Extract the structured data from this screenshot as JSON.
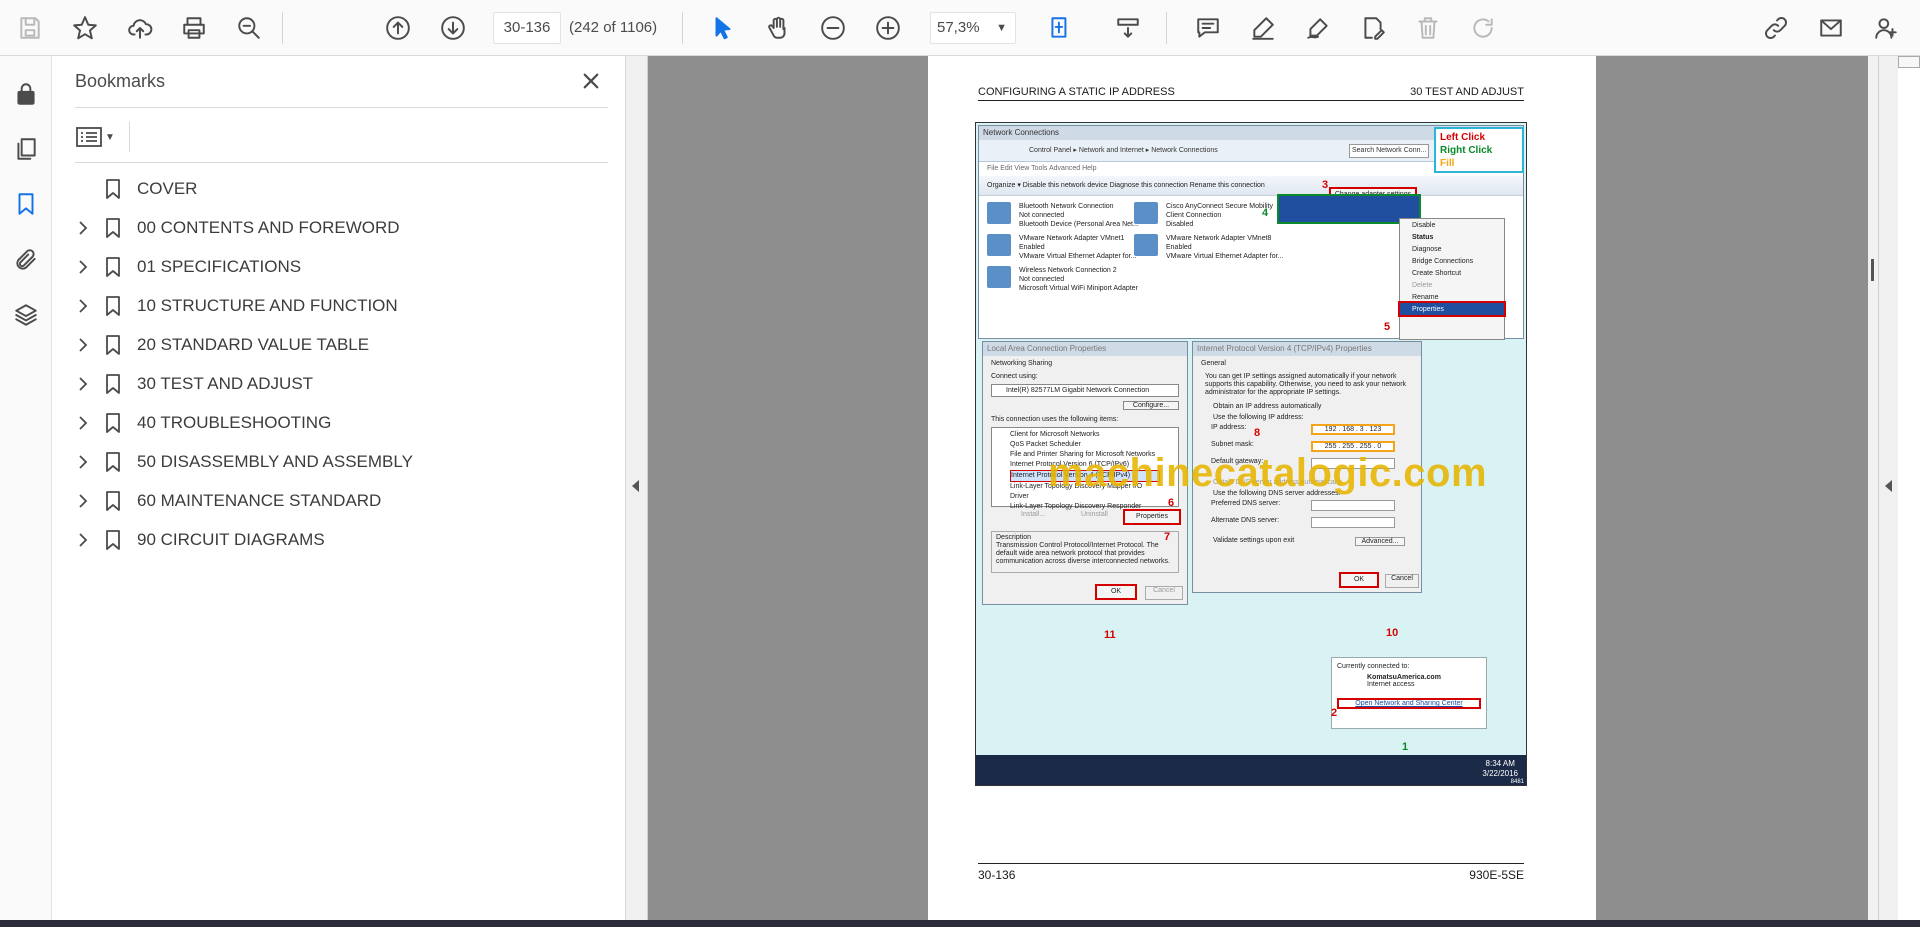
{
  "toolbar": {
    "page_input": "30-136",
    "page_count": "(242 of 1106)",
    "zoom": "57,3%"
  },
  "bookmarks": {
    "title": "Bookmarks",
    "items": [
      {
        "label": "COVER",
        "expandable": false
      },
      {
        "label": "00 CONTENTS AND FOREWORD",
        "expandable": true
      },
      {
        "label": "01 SPECIFICATIONS",
        "expandable": true
      },
      {
        "label": "10 STRUCTURE AND FUNCTION",
        "expandable": true
      },
      {
        "label": "20 STANDARD VALUE TABLE",
        "expandable": true
      },
      {
        "label": "30 TEST AND ADJUST",
        "expandable": true
      },
      {
        "label": "40 TROUBLESHOOTING",
        "expandable": true
      },
      {
        "label": "50 DISASSEMBLY AND ASSEMBLY",
        "expandable": true
      },
      {
        "label": "60 MAINTENANCE STANDARD",
        "expandable": true
      },
      {
        "label": "90 CIRCUIT DIAGRAMS",
        "expandable": true
      }
    ]
  },
  "document": {
    "header_left": "CONFIGURING A STATIC IP ADDRESS",
    "header_right": "30 TEST AND ADJUST",
    "footer_left": "30-136",
    "footer_right": "930E-5SE",
    "watermark": "machinecatalogic.com",
    "figure": {
      "window_title": "Network Connections",
      "address": "Control Panel  ▸  Network and Internet  ▸  Network Connections",
      "search": "Search Network Conn...",
      "menu": "File   Edit   View   Tools   Advanced   Help",
      "commands": "Organize ▾     Disable this network device     Diagnose this connection     Rename this connection",
      "change_adapter": "Change adapter settings",
      "legend": {
        "left": "Left Click",
        "right": "Right Click",
        "fill": "Fill"
      },
      "adapters": [
        {
          "name": "Bluetooth Network Connection",
          "status": "Not connected",
          "device": "Bluetooth Device (Personal Area Net..."
        },
        {
          "name": "Cisco AnyConnect Secure Mobility",
          "status": "Client Connection",
          "device": "Disabled"
        },
        {
          "name": "VMware Network Adapter VMnet1",
          "status": "Enabled",
          "device": "VMware Virtual Ethernet Adapter for..."
        },
        {
          "name": "VMware Network Adapter VMnet8",
          "status": "Enabled",
          "device": "VMware Virtual Ethernet Adapter for..."
        },
        {
          "name": "Wireless Network Connection 2",
          "status": "Not connected",
          "device": "Microsoft Virtual WiFi Miniport Adapter"
        }
      ],
      "context_menu": [
        "Disable",
        "Status",
        "Diagnose",
        "Bridge Connections",
        "Create Shortcut",
        "Delete",
        "Rename",
        "Properties"
      ],
      "lan_dialog": {
        "title": "Local Area Connection Properties",
        "tabs": "Networking   Sharing",
        "connect_using": "Connect using:",
        "adapter": "Intel(R) 82577LM Gigabit Network Connection",
        "configure": "Configure...",
        "items_label": "This connection uses the following items:",
        "items": [
          "Client for Microsoft Networks",
          "QoS Packet Scheduler",
          "File and Printer Sharing for Microsoft Networks",
          "Internet Protocol Version 6 (TCP/IPv6)",
          "Internet Protocol Version 4 (TCP/IPv4)",
          "Link-Layer Topology Discovery Mapper I/O Driver",
          "Link-Layer Topology Discovery Responder"
        ],
        "install": "Install...",
        "uninstall": "Uninstall",
        "properties": "Properties",
        "description_label": "Description",
        "description": "Transmission Control Protocol/Internet Protocol. The default wide area network protocol that provides communication across diverse interconnected networks.",
        "ok": "OK",
        "cancel": "Cancel"
      },
      "ipv4_dialog": {
        "title": "Internet Protocol Version 4 (TCP/IPv4) Properties",
        "tab": "General",
        "info": "You can get IP settings assigned automatically if your network supports this capability. Otherwise, you need to ask your network administrator for the appropriate IP settings.",
        "auto": "Obtain an IP address automatically",
        "manual": "Use the following IP address:",
        "ip_label": "IP address:",
        "ip_value": "192 . 168 . 3 . 123",
        "mask_label": "Subnet mask:",
        "mask_value": "255 . 255 . 255 . 0",
        "gateway_label": "Default gateway:",
        "dns_auto": "Obtain DNS server address automatically",
        "dns_manual": "Use the following DNS server addresses:",
        "dns_pref": "Preferred DNS server:",
        "dns_alt": "Alternate DNS server:",
        "validate": "Validate settings upon exit",
        "advanced": "Advanced...",
        "ok": "OK",
        "cancel": "Cancel"
      },
      "popup": {
        "connected": "Currently connected to:",
        "network": "KomatsuAmerica.com",
        "access": "Internet access",
        "link": "Open Network and Sharing Center"
      },
      "clock_time": "8:34 AM",
      "clock_date": "3/22/2016",
      "fig_id": "8481",
      "steps": [
        "1",
        "2",
        "3",
        "4",
        "5",
        "6",
        "7",
        "8",
        "10",
        "11"
      ]
    }
  }
}
